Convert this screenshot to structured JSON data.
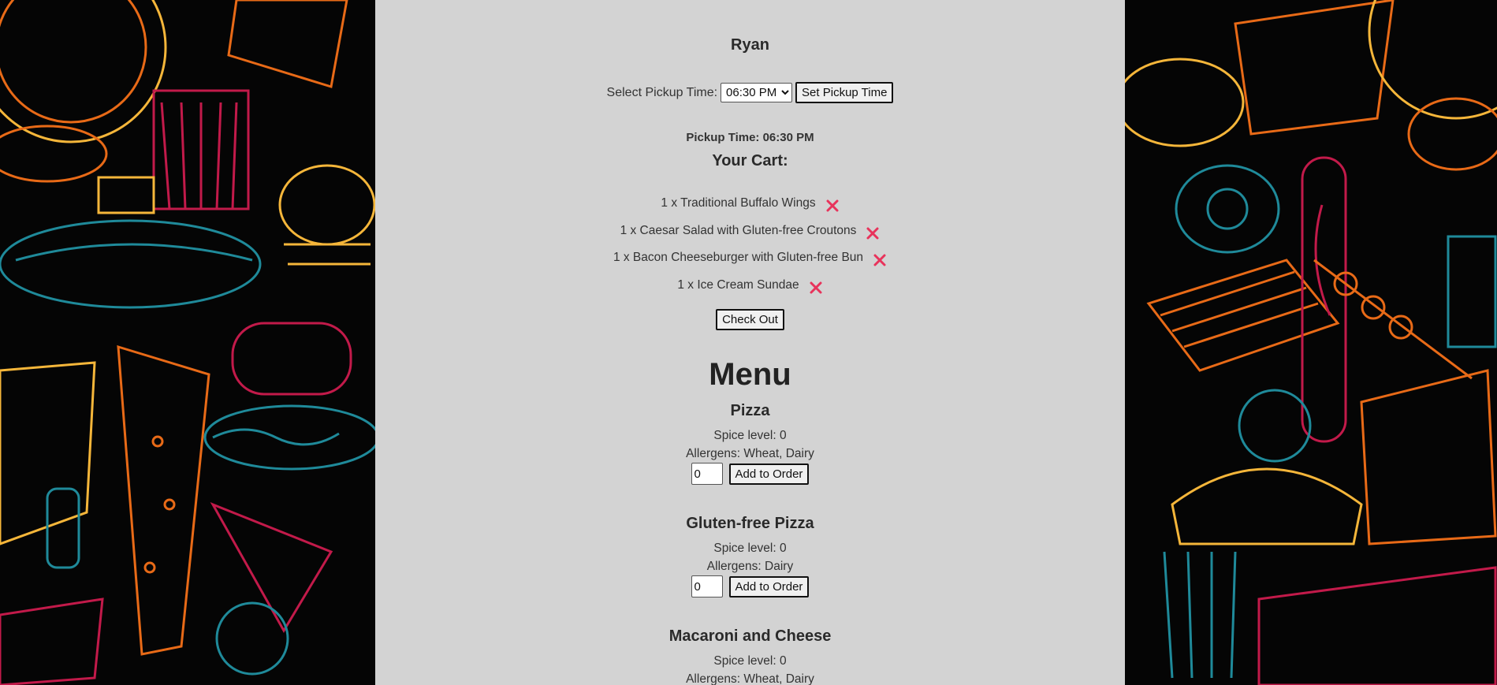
{
  "user": {
    "name": "Ryan"
  },
  "pickup": {
    "label": "Select Pickup Time:",
    "selected": "06:30 PM",
    "set_button": "Set Pickup Time",
    "current_text": "Pickup Time: 06:30 PM"
  },
  "cart": {
    "title": "Your Cart:",
    "items": [
      {
        "text": "1 x Traditional Buffalo Wings"
      },
      {
        "text": "1 x Caesar Salad with Gluten-free Croutons"
      },
      {
        "text": "1 x Bacon Cheeseburger with Gluten-free Bun"
      },
      {
        "text": "1 x Ice Cream Sundae"
      }
    ],
    "remove_icon": "close-icon",
    "remove_color": "#e8335b",
    "checkout_button": "Check Out"
  },
  "menu": {
    "title": "Menu",
    "add_button": "Add to Order",
    "items": [
      {
        "name": "Pizza",
        "spice": "Spice level: 0",
        "allergens": "Allergens: Wheat, Dairy",
        "qty": "0"
      },
      {
        "name": "Gluten-free Pizza",
        "spice": "Spice level: 0",
        "allergens": "Allergens: Dairy",
        "qty": "0"
      },
      {
        "name": "Macaroni and Cheese",
        "spice": "Spice level: 0",
        "allergens": "Allergens: Wheat, Dairy"
      }
    ]
  },
  "colors": {
    "panel": "#d3d3d3",
    "background": "#050505",
    "doodle_orange": "#e86a17",
    "doodle_yellow": "#f5b63a",
    "doodle_teal": "#1f8a9a",
    "doodle_crimson": "#c21a4a"
  }
}
